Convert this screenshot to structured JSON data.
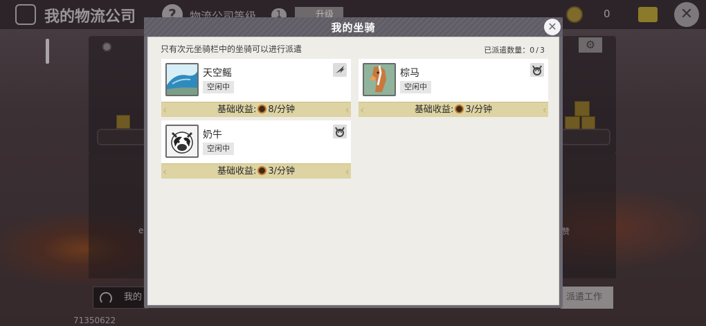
{
  "background": {
    "title": "我的物流公司",
    "level_label": "物流公司等级",
    "level_value": "1",
    "upgrade_label": "升级",
    "coin_count": "0",
    "bottom_left_label": "我的",
    "dispatch_button_label": "派遣工作",
    "left_text": "e",
    "right_text": "赞",
    "user_id": "71350622"
  },
  "modal": {
    "title": "我的坐骑",
    "hint": "只有次元坐骑栏中的坐骑可以进行派遣",
    "dispatch_count_label": "已派遣数量：",
    "dispatch_count_current": "0",
    "dispatch_count_sep": "/",
    "dispatch_count_max": "3"
  },
  "mounts": [
    {
      "name": "天空鳐",
      "status": "空闲中",
      "type_icon": "wing-icon",
      "income_label": "基础收益:",
      "income_value": "8/分钟"
    },
    {
      "name": "棕马",
      "status": "空闲中",
      "type_icon": "beast-icon",
      "income_label": "基础收益:",
      "income_value": "3/分钟"
    },
    {
      "name": "奶牛",
      "status": "空闲中",
      "type_icon": "beast-icon",
      "income_label": "基础收益:",
      "income_value": "3/分钟"
    }
  ],
  "colors": {
    "modal_header": "#67646e",
    "card_income_bar": "#ddd3a3",
    "panel_background": "#eeede8"
  }
}
